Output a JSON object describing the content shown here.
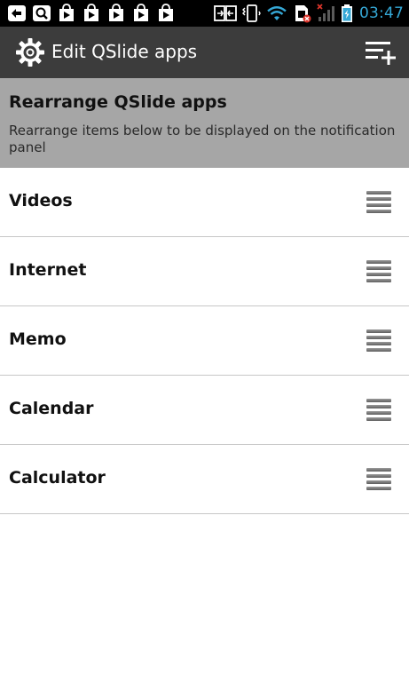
{
  "status_bar": {
    "time": "03:47",
    "left_icons": [
      "back-arrow-icon",
      "search-icon",
      "play-store-icon",
      "play-store-icon",
      "play-store-icon",
      "play-store-icon",
      "play-store-icon"
    ],
    "right_icons": [
      "screen-mirror-icon",
      "vibrate-icon",
      "wifi-icon",
      "no-sim-icon",
      "signal-icon",
      "battery-charging-icon"
    ],
    "accent_color": "#35a8d6"
  },
  "action_bar": {
    "title": "Edit QSlide apps",
    "settings_icon": "gear-icon",
    "add_icon": "add-list-icon"
  },
  "header": {
    "title": "Rearrange QSlide apps",
    "description": "Rearrange items below to be displayed on the notification panel"
  },
  "apps": [
    {
      "label": "Videos"
    },
    {
      "label": "Internet"
    },
    {
      "label": "Memo"
    },
    {
      "label": "Calendar"
    },
    {
      "label": "Calculator"
    }
  ]
}
